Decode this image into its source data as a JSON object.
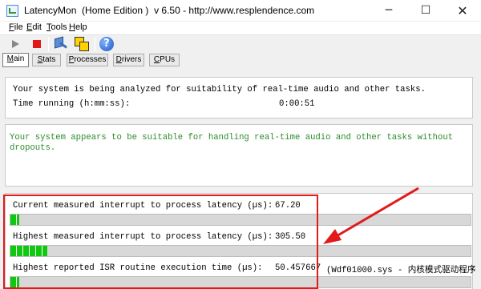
{
  "window": {
    "title": "LatencyMon  (Home Edition )  v 6.50 - http://www.resplendence.com",
    "minimize": "─",
    "maximize": "☐",
    "close": "✕"
  },
  "menu": {
    "items": [
      "File",
      "Edit",
      "Tools",
      "Help"
    ]
  },
  "toolbar": {
    "help_glyph": "?"
  },
  "tabs": [
    {
      "label": "Main",
      "active": true
    },
    {
      "label": "Stats",
      "active": false
    },
    {
      "label": "Processes",
      "active": false
    },
    {
      "label": "Drivers",
      "active": false
    },
    {
      "label": "CPUs",
      "active": false
    }
  ],
  "status": {
    "analysis_text": "Your system is being analyzed for suitability of real-time audio and other tasks.",
    "time_running_label": "Time running (h:mm:ss):",
    "time_running_value": "0:00:51"
  },
  "verdict": {
    "text": "Your system appears to be suitable for handling real-time audio and other tasks without dropouts.",
    "color": "#2e8b2e"
  },
  "measurements": [
    {
      "label": "Current measured interrupt to process latency (µs):",
      "value": "67.20",
      "extra": "",
      "bar_fraction": 0.02
    },
    {
      "label": "Highest measured interrupt to process latency (µs):",
      "value": "305.50",
      "extra": "",
      "bar_fraction": 0.08
    },
    {
      "label": "Highest reported ISR routine execution time (µs):",
      "value": "50.457667",
      "extra": "(Wdf01000.sys - 内核模式驱动程序",
      "bar_fraction": 0.02
    }
  ],
  "annotation": {
    "color": "#e11a1a"
  }
}
